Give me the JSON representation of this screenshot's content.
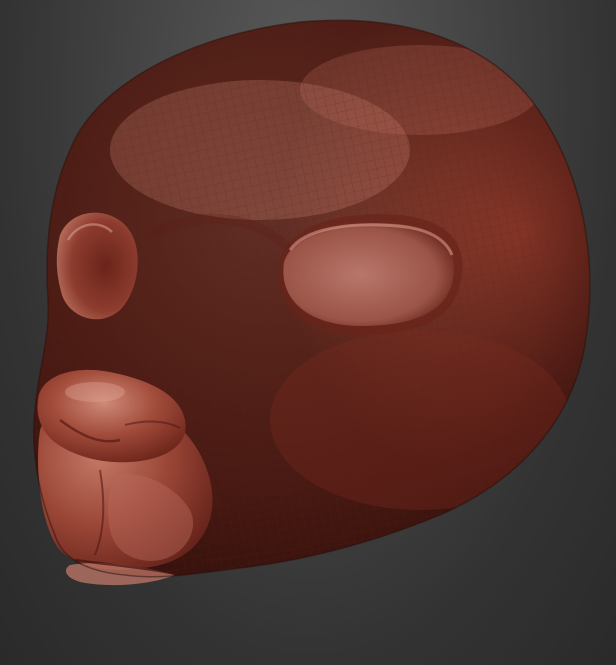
{
  "scene": {
    "subject": "head-mask-sculpt",
    "background_color": "#3c3c3c",
    "material_colors": {
      "base": "#8e3a2c",
      "highlight": "#c9806e",
      "shadow": "#3e1410",
      "wire": "#5a2018"
    },
    "wireframe_visible": true
  }
}
